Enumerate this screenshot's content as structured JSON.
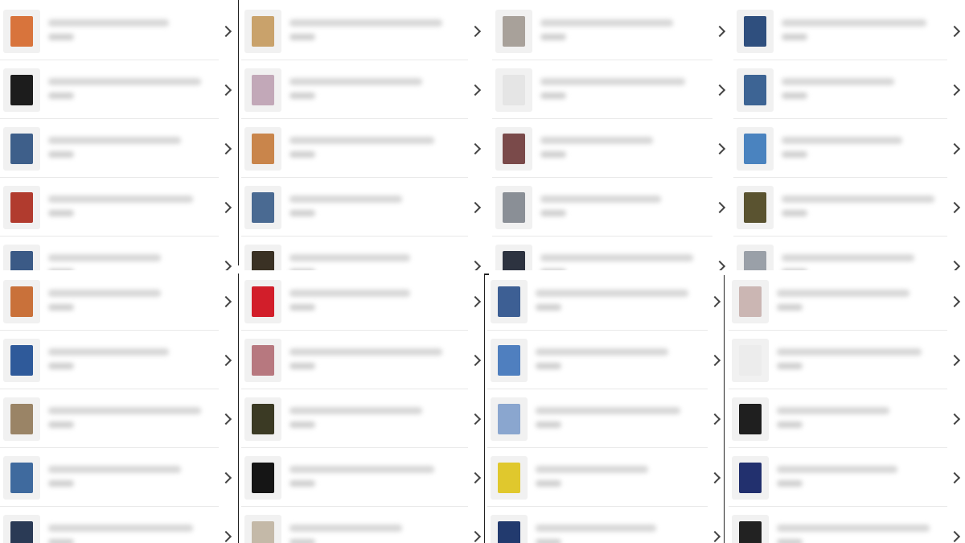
{
  "colors": {
    "chevron": "#444444",
    "separator": "#e9e9e9",
    "blur_text": "#d7d7d7"
  },
  "panels": [
    {
      "id": "p1",
      "items": [
        {
          "icon": "manga-cover-icon",
          "color": "#d8743c"
        },
        {
          "icon": "black-sweater-icon",
          "color": "#1c1c1c"
        },
        {
          "icon": "denim-jeans-icon",
          "color": "#3e5f8a"
        },
        {
          "icon": "plaid-shirt-icon",
          "color": "#b13b2e"
        },
        {
          "icon": "denim-shorts-icon",
          "color": "#3b5a86"
        }
      ]
    },
    {
      "id": "p2",
      "items": [
        {
          "icon": "poster-icon",
          "color": "#c9a26b"
        },
        {
          "icon": "poster-icon",
          "color": "#c2a8b8"
        },
        {
          "icon": "poster-icon",
          "color": "#c9854b"
        },
        {
          "icon": "denim-jacket-icon",
          "color": "#4a6a92"
        },
        {
          "icon": "black-jacket-icon",
          "color": "#3a3124"
        }
      ]
    },
    {
      "id": "p3",
      "items": [
        {
          "icon": "scarf-icon",
          "color": "#a8a19a"
        },
        {
          "icon": "white-tshirt-icon",
          "color": "#e5e5e5"
        },
        {
          "icon": "person-photo-icon",
          "color": "#7a4a4a"
        },
        {
          "icon": "gray-cardigan-icon",
          "color": "#8a8f96"
        },
        {
          "icon": "black-coat-icon",
          "color": "#2d3340"
        }
      ]
    },
    {
      "id": "p4",
      "items": [
        {
          "icon": "denim-shorts-icon",
          "color": "#2f4f7e"
        },
        {
          "icon": "denim-jacket-icon",
          "color": "#3d6494"
        },
        {
          "icon": "blue-jacket-icon",
          "color": "#4a83bf"
        },
        {
          "icon": "olive-jacket-icon",
          "color": "#5a5330"
        },
        {
          "icon": "gray-item-icon",
          "color": "#9aa0a8"
        }
      ]
    },
    {
      "id": "p5",
      "items": [
        {
          "icon": "orange-jacket-icon",
          "color": "#c9713a"
        },
        {
          "icon": "denim-jeans-icon",
          "color": "#2f5a9a"
        },
        {
          "icon": "khaki-pants-icon",
          "color": "#9a8466"
        },
        {
          "icon": "denim-shorts-icon",
          "color": "#3f6a9e"
        },
        {
          "icon": "navy-tshirt-icon",
          "color": "#2a3a55"
        }
      ]
    },
    {
      "id": "p6",
      "items": [
        {
          "icon": "mouse-ears-headband-icon",
          "color": "#d21e2a"
        },
        {
          "icon": "graphic-tshirt-icon",
          "color": "#b7787f"
        },
        {
          "icon": "olive-sweater-icon",
          "color": "#3b3a24"
        },
        {
          "icon": "black-dress-icon",
          "color": "#151515"
        },
        {
          "icon": "knit-sweater-icon",
          "color": "#c4b9a8"
        }
      ]
    },
    {
      "id": "p7",
      "items": [
        {
          "icon": "denim-jeans-icon",
          "color": "#3d5f94"
        },
        {
          "icon": "plaid-shirt-icon",
          "color": "#4f7fbf"
        },
        {
          "icon": "blue-vest-icon",
          "color": "#8aa6cf"
        },
        {
          "icon": "toy-box-icon",
          "color": "#e0c82d"
        },
        {
          "icon": "navy-sweater-icon",
          "color": "#223a6e"
        }
      ]
    },
    {
      "id": "p8",
      "items": [
        {
          "icon": "pink-cardigan-icon",
          "color": "#cbb6b3"
        },
        {
          "icon": "white-sweatshirt-icon",
          "color": "#ececec"
        },
        {
          "icon": "black-pants-icon",
          "color": "#1f1f1f"
        },
        {
          "icon": "navy-pants-icon",
          "color": "#22306e"
        },
        {
          "icon": "black-pants-icon",
          "color": "#222222"
        }
      ]
    }
  ]
}
